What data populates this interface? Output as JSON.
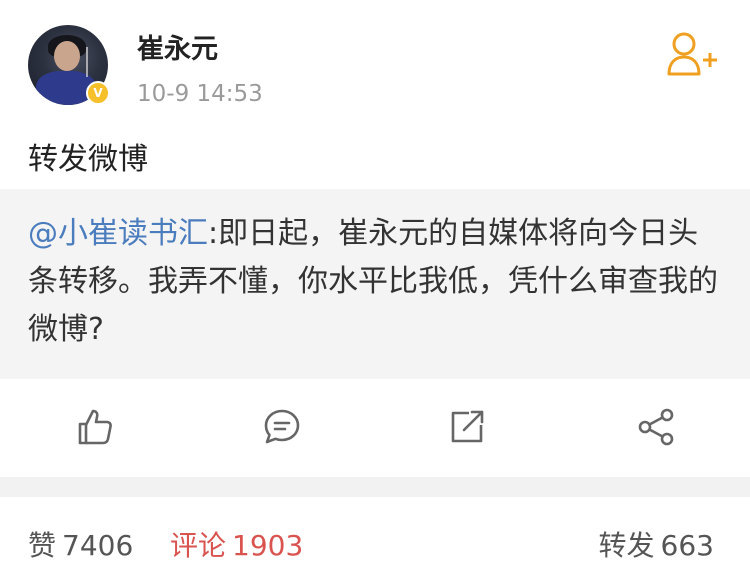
{
  "user": {
    "name": "崔永元",
    "timestamp": "10-9 14:53",
    "verified_mark": "V",
    "avatar_icon": "user-avatar-photo"
  },
  "post": {
    "text": "转发微博"
  },
  "repost": {
    "mention": "@小崔读书汇",
    "body": ":即日起，崔永元的自媒体将向今日头条转移。我弄不懂，你水平比我低，凭什么审查我的微博?"
  },
  "actions": {
    "like_icon": "thumbs-up-icon",
    "comment_icon": "comment-icon",
    "repost_icon": "repost-icon",
    "share_icon": "share-icon"
  },
  "stats": {
    "likes_label": "赞",
    "likes_count": "7406",
    "comments_label": "评论",
    "comments_count": "1903",
    "reposts_label": "转发",
    "reposts_count": "663"
  },
  "colors": {
    "mention": "#4b7cbd",
    "comments": "#d9534f",
    "follow_icon": "#f0a020",
    "verified_badge": "#f5c02a",
    "repost_background": "#f4f4f4"
  }
}
